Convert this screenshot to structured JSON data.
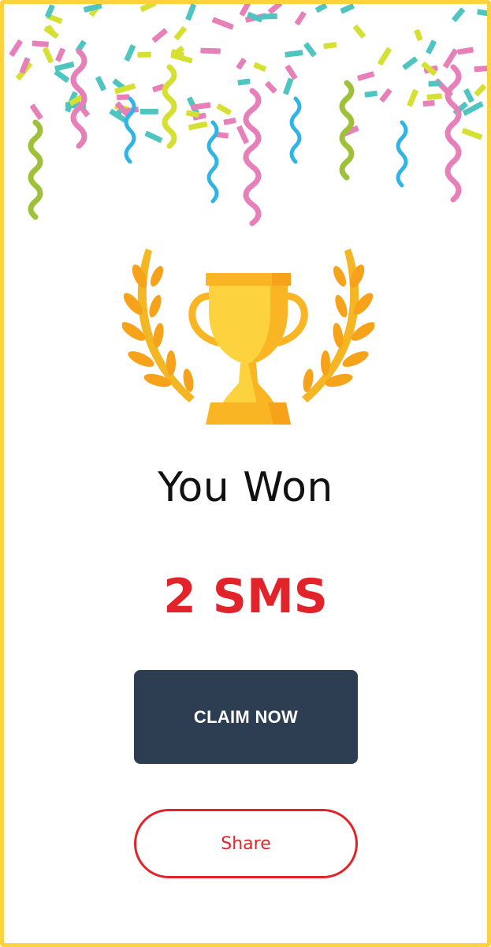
{
  "result": {
    "title": "You Won",
    "prize": "2 SMS"
  },
  "actions": {
    "claim_label": "CLAIM NOW",
    "share_label": "Share"
  },
  "theme": {
    "frame": "#fcd33e",
    "accent": "#e22329",
    "button_dark": "#2d3e53",
    "confetti": [
      "#4ec5c1",
      "#e77fb8",
      "#d5e033",
      "#2fb4e6",
      "#7aa83a"
    ]
  },
  "icons": {
    "decoration": "confetti-streamers",
    "trophy": "trophy-laurel-icon"
  }
}
